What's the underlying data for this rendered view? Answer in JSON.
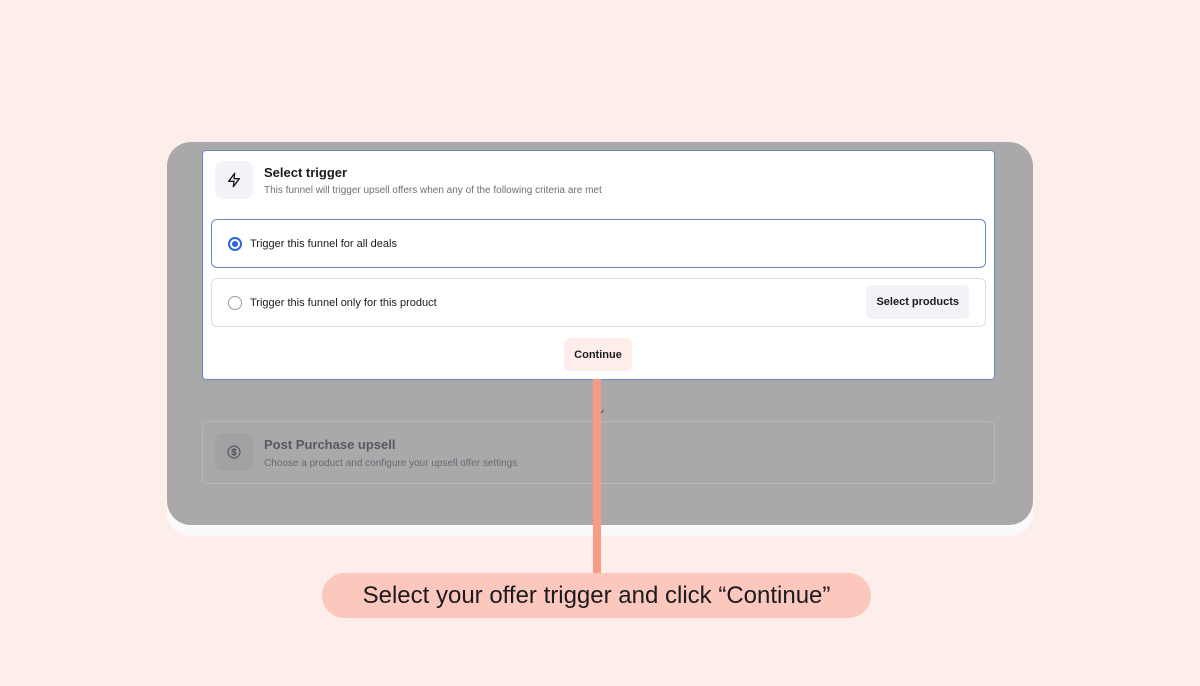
{
  "modal": {
    "title": "Select trigger",
    "subtitle": "This funnel will trigger upsell offers when any of the following criteria are met",
    "icon": "lightning-icon",
    "options": [
      {
        "label": "Trigger this funnel for all deals",
        "selected": true
      },
      {
        "label": "Trigger this funnel only for this product",
        "selected": false
      }
    ],
    "select_products_label": "Select products",
    "continue_label": "Continue"
  },
  "background_card": {
    "title": "Post Purchase upsell",
    "subtitle": "Choose a product and configure your upsell offer settings",
    "icon": "dollar-circle-icon"
  },
  "callout": {
    "text": "Select your offer trigger and click “Continue”"
  },
  "colors": {
    "page_background": "#fdeeeb",
    "overlay": "#a9a9ab",
    "accent_blue": "#2f64d8",
    "pointer": "#f79a86",
    "callout": "#fcc8bd"
  }
}
